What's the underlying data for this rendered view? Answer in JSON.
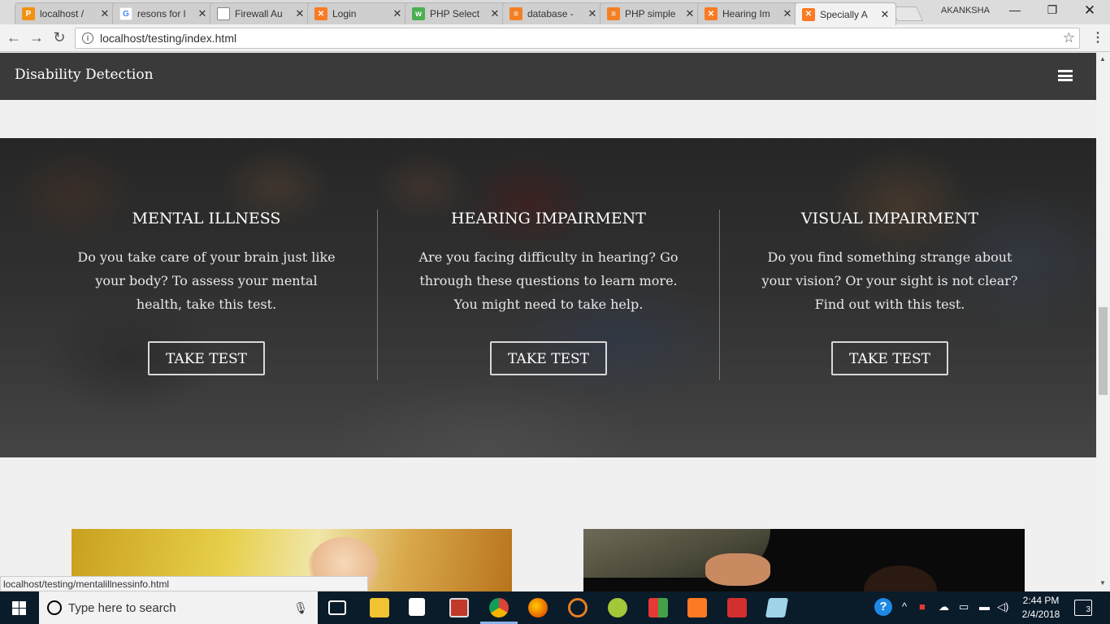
{
  "tabs": [
    {
      "title": "localhost /",
      "favicon": "pma-icon",
      "color": "#f29111"
    },
    {
      "title": "resons for l",
      "favicon": "google-icon",
      "color": "#4285f4"
    },
    {
      "title": "Firewall Au",
      "favicon": "page-icon",
      "color": "#888888"
    },
    {
      "title": "Login",
      "favicon": "xampp-icon",
      "color": "#fb7a24"
    },
    {
      "title": "PHP Select",
      "favicon": "w3-icon",
      "color": "#4caf50"
    },
    {
      "title": "database -",
      "favicon": "stackoverflow-icon",
      "color": "#f48024"
    },
    {
      "title": "PHP simple",
      "favicon": "stackoverflow-icon",
      "color": "#f48024"
    },
    {
      "title": "Hearing Im",
      "favicon": "xampp-icon",
      "color": "#fb7a24"
    },
    {
      "title": "Specially A",
      "favicon": "xampp-icon",
      "color": "#fb7a24"
    }
  ],
  "profile_name": "AKANKSHA",
  "address_bar": {
    "url": "localhost/testing/index.html"
  },
  "site": {
    "brand": "Disability Detection",
    "sections": [
      {
        "title": "MENTAL ILLNESS",
        "text": "Do you take care of your brain just like your body? To assess your mental health, take this test.",
        "button": "TAKE TEST"
      },
      {
        "title": "HEARING IMPAIRMENT",
        "text": "Are you facing difficulty in hearing? Go through these questions to learn more. You might need to take help.",
        "button": "TAKE TEST"
      },
      {
        "title": "VISUAL IMPAIRMENT",
        "text": "Do you find something strange about your vision? Or your sight is not clear? Find out with this test.",
        "button": "TAKE TEST"
      }
    ]
  },
  "status_url": "localhost/testing/mentalillnessinfo.html",
  "taskbar": {
    "search_placeholder": "Type here to search",
    "time": "2:44 PM",
    "date": "2/4/2018",
    "notifications": "3"
  }
}
